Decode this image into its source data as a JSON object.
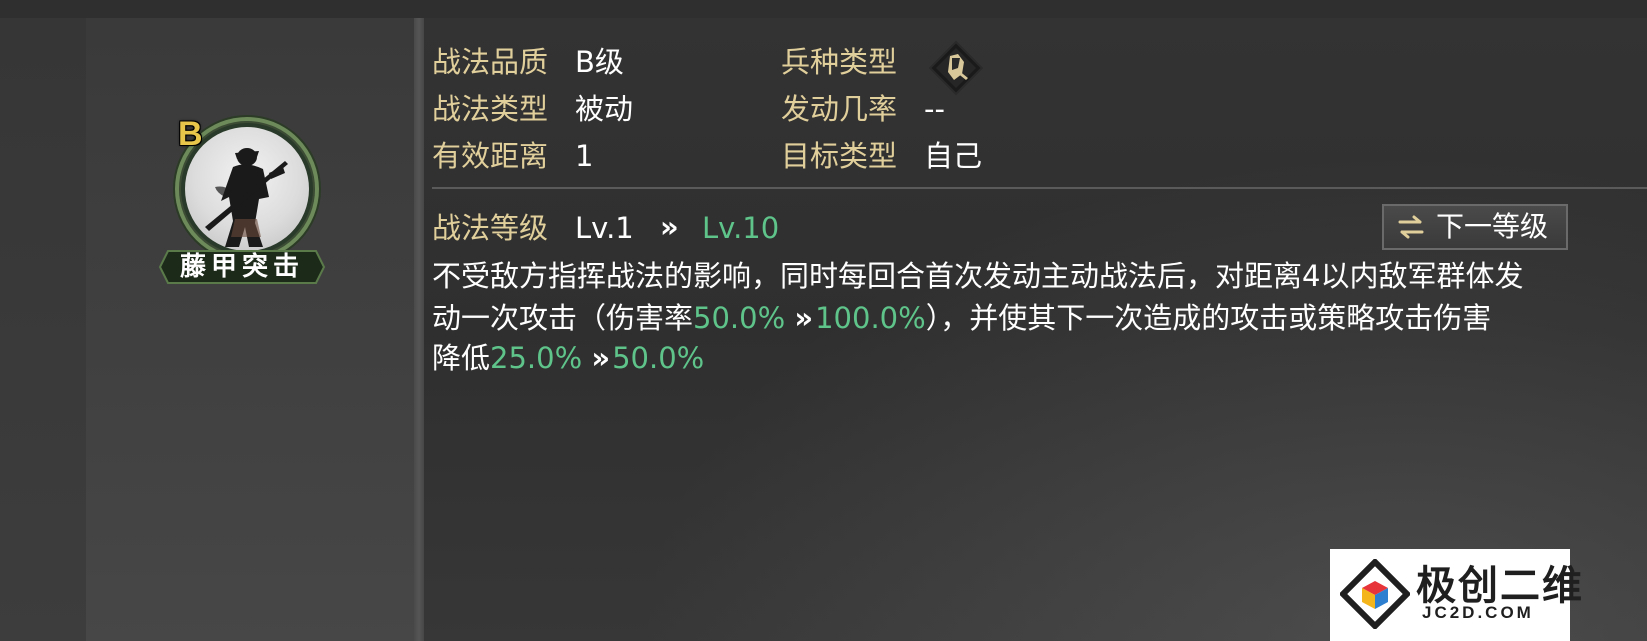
{
  "skill": {
    "grade_badge": "B",
    "name": "藤甲突击"
  },
  "info": {
    "quality_label": "战法品质",
    "quality_value": "B级",
    "type_label": "战法类型",
    "type_value": "被动",
    "range_label": "有效距离",
    "range_value": "1",
    "troop_label": "兵种类型",
    "troop_icon": "infantry-troop-icon",
    "chance_label": "发动几率",
    "chance_value": "--",
    "target_label": "目标类型",
    "target_value": "自己"
  },
  "level": {
    "label": "战法等级",
    "current": "Lv.1",
    "arrow": "»",
    "max": "Lv.10",
    "next_button_label": "下一等级",
    "next_button_icon": "swap-arrows-icon"
  },
  "description": {
    "line1": "不受敌方指挥战法的影响，同时每回合首次发动主动战法后，对距离4以内敌军群体发",
    "line2_a": "动一次攻击（伤害率",
    "line2_v1": "50.0%",
    "line2_arrow": "»",
    "line2_v2": "100.0%",
    "line2_b": "），并使其下一次造成的攻击或策略攻击伤害",
    "line3_a": "降低",
    "line3_v1": "25.0%",
    "line3_arrow": "»",
    "line3_v2": "50.0%"
  },
  "watermark": {
    "title": "极创二维",
    "domain": "JC2D.COM"
  },
  "colors": {
    "label_gold": "#e1cf9b",
    "value_white": "#ffffff",
    "highlight_green": "#5ec48a",
    "grade_yellow": "#e8c64a"
  }
}
